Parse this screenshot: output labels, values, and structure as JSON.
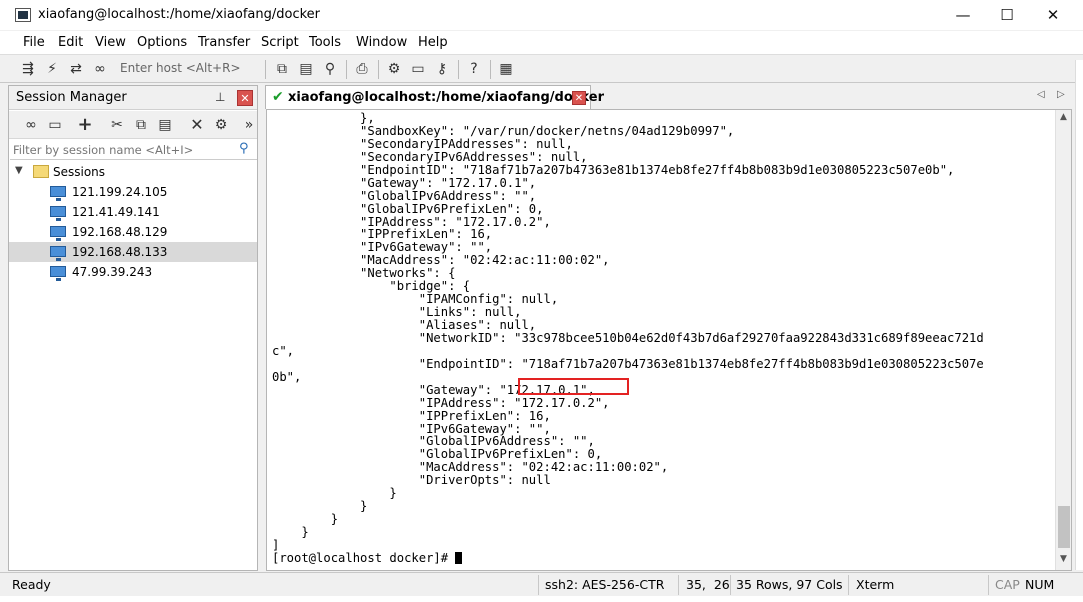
{
  "window": {
    "title": "xiaofang@localhost:/home/xiaofang/docker",
    "min_glyph": "—",
    "max_glyph": "☐",
    "close_glyph": "✕"
  },
  "menu": {
    "items": [
      "File",
      "Edit",
      "View",
      "Options",
      "Transfer",
      "Script",
      "Tools",
      "Window",
      "Help"
    ]
  },
  "toolbar": {
    "enter_host_placeholder": "Enter host <Alt+R>",
    "icons": [
      "connect-icon",
      "lightning-icon",
      "reconnect-icon",
      "link-icon",
      "copy-icon",
      "paste-icon",
      "find-icon",
      "print-icon",
      "settings-icon",
      "keymap-icon",
      "key-icon",
      "help-icon",
      "sftp-icon"
    ]
  },
  "session_manager": {
    "title": "Session Manager",
    "pin_glyph": "⊥",
    "close_glyph": "✕",
    "filter_placeholder": "Filter by session name <Alt+I>",
    "folder_label": "Sessions",
    "sessions": [
      "121.199.24.105",
      "121.41.49.141",
      "192.168.48.129",
      "192.168.48.133",
      "47.99.39.243"
    ],
    "selected_session": "192.168.48.133"
  },
  "tab": {
    "title": "xiaofang@localhost:/home/xiaofang/docker",
    "close_glyph": "✕"
  },
  "terminal": {
    "lines": [
      "            },",
      "            \"SandboxKey\": \"/var/run/docker/netns/04ad129b0997\",",
      "            \"SecondaryIPAddresses\": null,",
      "            \"SecondaryIPv6Addresses\": null,",
      "            \"EndpointID\": \"718af71b7a207b47363e81b1374eb8fe27ff4b8b083b9d1e030805223c507e0b\",",
      "            \"Gateway\": \"172.17.0.1\",",
      "            \"GlobalIPv6Address\": \"\",",
      "            \"GlobalIPv6PrefixLen\": 0,",
      "            \"IPAddress\": \"172.17.0.2\",",
      "            \"IPPrefixLen\": 16,",
      "            \"IPv6Gateway\": \"\",",
      "            \"MacAddress\": \"02:42:ac:11:00:02\",",
      "            \"Networks\": {",
      "                \"bridge\": {",
      "                    \"IPAMConfig\": null,",
      "                    \"Links\": null,",
      "                    \"Aliases\": null,",
      "                    \"NetworkID\": \"33c978bcee510b04e62d0f43b7d6af29270faa922843d331c689f89eeac721d",
      "c\",",
      "                    \"EndpointID\": \"718af71b7a207b47363e81b1374eb8fe27ff4b8b083b9d1e030805223c507e",
      "0b\",",
      "                    \"Gateway\": \"172.17.0.1\",",
      "                    \"IPAddress\": \"172.17.0.2\",",
      "                    \"IPPrefixLen\": 16,",
      "                    \"IPv6Gateway\": \"\",",
      "                    \"GlobalIPv6Address\": \"\",",
      "                    \"GlobalIPv6PrefixLen\": 0,",
      "                    \"MacAddress\": \"02:42:ac:11:00:02\",",
      "                    \"DriverOpts\": null",
      "                }",
      "            }",
      "        }",
      "    }",
      "]"
    ],
    "prompt": "[root@localhost docker]# ",
    "highlight_color": "#e32222"
  },
  "status": {
    "ready": "Ready",
    "encryption": "ssh2: AES-256-CTR",
    "position": "35,  26",
    "dimensions": "35 Rows, 97 Cols",
    "terminal_type": "Xterm",
    "cap": "CAP",
    "num": "NUM"
  },
  "colors": {
    "accent_red": "#d9534f",
    "check_green": "#1a9c2a"
  }
}
